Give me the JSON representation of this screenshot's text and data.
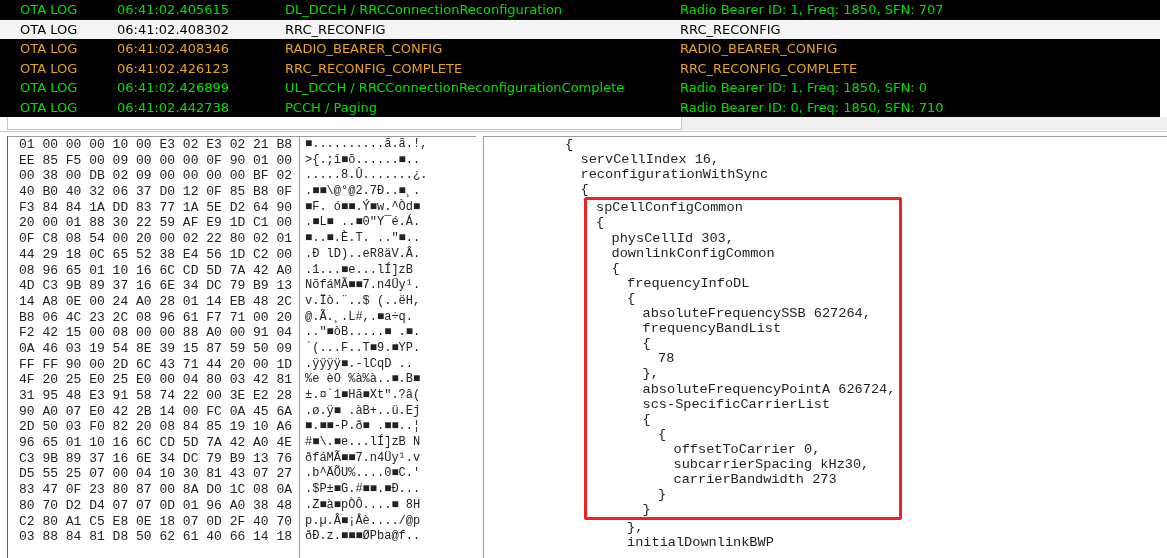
{
  "log_table": {
    "rows": [
      {
        "type": "OTA LOG",
        "time": "06:41:02.405615",
        "name": "DL_DCCH / RRCConnectionReconfiguration",
        "info": "Radio Bearer ID: 1, Freq: 1850, SFN: 707",
        "color": "#00e000",
        "selected": false
      },
      {
        "type": "OTA LOG",
        "time": "06:41:02.408302",
        "name": "RRC_RECONFIG",
        "info": "RRC_RECONFIG",
        "selected": true
      },
      {
        "type": "OTA LOG",
        "time": "06:41:02.408346",
        "name": "RADIO_BEARER_CONFIG",
        "info": "RADIO_BEARER_CONFIG",
        "color": "#e8a317",
        "selected": false
      },
      {
        "type": "OTA LOG",
        "time": "06:41:02.426123",
        "name": "RRC_RECONFIG_COMPLETE",
        "info": "RRC_RECONFIG_COMPLETE",
        "color": "#e8a317",
        "selected": false
      },
      {
        "type": "OTA LOG",
        "time": "06:41:02.426899",
        "name": "UL_DCCH / RRCConnectionReconfigurationComplete",
        "info": "Radio Bearer ID: 1, Freq: 1850, SFN: 0",
        "color": "#00e000",
        "selected": false
      },
      {
        "type": "OTA LOG",
        "time": "06:41:02.442738",
        "name": "PCCH / Paging",
        "info": "Radio Bearer ID: 0, Freq: 1850, SFN: 710",
        "color": "#00e000",
        "selected": false
      }
    ]
  },
  "hex_dump": {
    "rows": [
      {
        "bytes": "01 00 00 00 10 00 E3 02 E3 02 21 B8",
        "ascii": "■..........ã.ã.!,"
      },
      {
        "bytes": "EE 85 F5 00 09 00 00 00 0F 90 01 00",
        "ascii": ">{.;î■õ......■.."
      },
      {
        "bytes": "00 38 00 DB 02 09 00 00 00 00 BF 02",
        "ascii": ".....8.Û.......¿."
      },
      {
        "bytes": "40 B0 40 32 06 37 D0 12 0F 85 B8 0F",
        "ascii": ".■■\\@°@2.7Ð..■¸."
      },
      {
        "bytes": "F3 84 84 1A DD 83 77 1A 5E D2 64 90",
        "ascii": "■F. ó■■.Ý■w.^Òd■"
      },
      {
        "bytes": "20 00 01 88 30 22 59 AF E9 1D C1 00",
        "ascii": ".■L■ ..■0\"Y¯é.Á."
      },
      {
        "bytes": "0F C8 08 54 00 20 00 02 22 80 02 01",
        "ascii": "■..■.È.T. ..\"■.."
      },
      {
        "bytes": "44 29 18 0C 65 52 38 E4 56 1D C2 00",
        "ascii": ".Ð lD)..eR8äV.Â."
      },
      {
        "bytes": "08 96 65 01 10 16 6C CD 5D 7A 42 A0",
        "ascii": ".1...■e...lÍ]zB"
      },
      {
        "bytes": "4D C3 9B 89 37 16 6E 34 DC 79 B9 13",
        "ascii": "NõfáMÃ■■7.n4Üy¹."
      },
      {
        "bytes": "14 A8 0E 00 24 A0 28 01 14 EB 48 2C",
        "ascii": "v.Ïò.¨..$ (..ëH,"
      },
      {
        "bytes": "B8 06 4C 23 2C 08 96 61 F7 71 00 20",
        "ascii": "@.Ã.¸.L#,.■a÷q."
      },
      {
        "bytes": "F2 42 15 00 08 00 00 88 A0 00 91 04",
        "ascii": "..\"■òB.....■ .■."
      },
      {
        "bytes": "0A 46 03 19 54 8E 39 15 87 59 50 09",
        "ascii": "´(...F..T■9.■YP."
      },
      {
        "bytes": "FF FF 90 00 2D 6C 43 71 44 20 00 1D",
        "ascii": ".ÿÿÿÿ■.-lCqD .."
      },
      {
        "bytes": "4F 20 25 E0 25 E0 00 04 80 03 42 81",
        "ascii": "%e èO %à%à..■.B■"
      },
      {
        "bytes": "31 95 48 E3 91 58 74 22 00 3E E2 28",
        "ascii": "±.¤`1■Hã■Xt\".?â("
      },
      {
        "bytes": "90 A0 07 E0 42 2B 14 00 FC 0A 45 6A",
        "ascii": ".ø.ÿ■ .àB+..ü.Ej"
      },
      {
        "bytes": "2D 50 03 F0 82 20 08 84 85 19 10 A6",
        "ascii": "■.■■-P.ð■ .■■..¦"
      },
      {
        "bytes": "96 65 01 10 16 6C CD 5D 7A 42 A0 4E",
        "ascii": "#■\\.■e...lÍ]zB N"
      },
      {
        "bytes": "C3 9B 89 37 16 6E 34 DC 79 B9 13 76",
        "ascii": "ðfáMÃ■■7.n4Üy¹.v"
      },
      {
        "bytes": "D5 55 25 07 00 04 10 30 81 43 07 27",
        "ascii": ".b^ÄÕU%....0■C.'"
      },
      {
        "bytes": "83 47 0F 23 80 87 00 8A D0 1C 08 0A",
        "ascii": ".$P±■G.#■■.■Ð..."
      },
      {
        "bytes": "80 70 D2 D4 07 07 0D 01 96 A0 38 48",
        "ascii": ".Z■à■pÒÔ....■ 8H"
      },
      {
        "bytes": "C2 80 A1 C5 E8 0E 18 07 0D 2F 40 70",
        "ascii": "p.µ.Â■¡Åè..../@p"
      },
      {
        "bytes": "03 88 84 81 D8 50 62 61 40 66 14 18",
        "ascii": "ðÐ.z.■■■ØPba@f.."
      }
    ]
  },
  "decoded": {
    "lines": [
      {
        "text": "{",
        "highlighted": false,
        "children": [
          {
            "text": "servCellIndex 16,",
            "highlighted": false
          },
          {
            "text": "reconfigurationWithSync",
            "highlighted": false
          },
          {
            "text": "{",
            "highlighted": false,
            "children": [
              {
                "text": "spCellConfigCommon",
                "highlighted": true
              },
              {
                "text": "{",
                "highlighted": true,
                "children": [
                  {
                    "text": "physCellId 303,",
                    "highlighted": true
                  },
                  {
                    "text": "downlinkConfigCommon",
                    "highlighted": true
                  },
                  {
                    "text": "{",
                    "highlighted": true,
                    "children": [
                      {
                        "text": "frequencyInfoDL",
                        "highlighted": true
                      },
                      {
                        "text": "{",
                        "highlighted": true,
                        "children": [
                          {
                            "text": "absoluteFrequencySSB 627264,",
                            "highlighted": true
                          },
                          {
                            "text": "frequencyBandList",
                            "highlighted": true
                          },
                          {
                            "text": "{",
                            "highlighted": true,
                            "children": [
                              {
                                "text": "78",
                                "highlighted": true
                              }
                            ]
                          },
                          {
                            "text": "},",
                            "highlighted": true
                          },
                          {
                            "text": "absoluteFrequencyPointA 626724,",
                            "highlighted": true
                          },
                          {
                            "text": "scs-SpecificCarrierList",
                            "highlighted": true
                          },
                          {
                            "text": "{",
                            "highlighted": true,
                            "children": [
                              {
                                "text": "{",
                                "highlighted": true,
                                "children": [
                                  {
                                    "text": "offsetToCarrier 0,",
                                    "highlighted": true
                                  },
                                  {
                                    "text": "subcarrierSpacing kHz30,",
                                    "highlighted": true
                                  },
                                  {
                                    "text": "carrierBandwidth 273",
                                    "highlighted": true
                                  }
                                ]
                              },
                              {
                                "text": "}",
                                "highlighted": true
                              }
                            ]
                          },
                          {
                            "text": "}",
                            "highlighted": true
                          }
                        ]
                      },
                      {
                        "text": "},",
                        "highlighted": false
                      },
                      {
                        "text": "initialDownlinkBWP",
                        "highlighted": false
                      }
                    ]
                  }
                ]
              }
            ]
          }
        ]
      }
    ]
  }
}
